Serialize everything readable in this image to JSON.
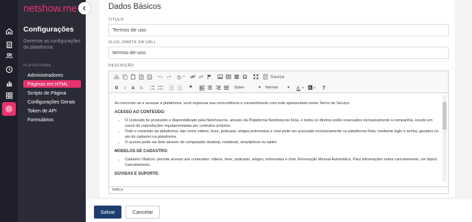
{
  "brand": {
    "logo_text": "netshow.me",
    "logo_color": "#e8336f"
  },
  "iconbar": [
    "home-icon",
    "document-icon",
    "users-icon",
    "clock-icon",
    "chart-icon",
    "apps-icon",
    "gear-icon"
  ],
  "sidebar": {
    "title": "Configurações",
    "subtitle": "Gerencie as configurações da plataforma",
    "section_label": "PLATAFORMA",
    "items": [
      {
        "label": "Administradores",
        "active": false
      },
      {
        "label": "Páginas em HTML",
        "active": true
      },
      {
        "label": "Scripts de Página",
        "active": false
      },
      {
        "label": "Configurações Gerais",
        "active": false
      },
      {
        "label": "Token de API",
        "active": false
      },
      {
        "label": "Formulários",
        "active": false
      }
    ]
  },
  "main": {
    "page_title": "Dados Básicos",
    "fields": {
      "title_label": "TÍTULO",
      "title_value": "Termos de uso",
      "slug_label": "SLUG (PARTE DA URL)",
      "slug_value": "termos-de-uso",
      "desc_label": "DESCRIÇÃO"
    },
    "editor": {
      "toolbar": {
        "source_label": "Source",
        "styles_label": "Styles",
        "format_label": "Normal"
      },
      "content": {
        "intro": "Ao inscrever-se e acessar a plataforma, você expressa sua concordância e consentimento com tudo apresentado neste Termo de Serviço.",
        "heading1": "ACESSO AO CONTEÚDO:",
        "list1": [
          "O conteúdo foi produzido e disponibilizado pela Netshow.me, através da Plataforma Netshow.me Flow, e todos os direitos estão reservados exclusivamente à companhia, exceto em casos de coproduções regulamentadas por contratos próprios.",
          "Todo o conteúdo da plataforma, tais como vídeos, lives, podcasts, artigos,entrevistas e chat pode ser acessado exclusivamente na plataforma Flow, mediante login e senha, gerados no ato do cadastro na plataforma.",
          "O acesso pode ser feito através de computador desktop, notebook, smartphone ou tablet."
        ],
        "heading2": "MODELOS DE CADASTRO:",
        "list2": [
          "Cadastro Vitalício: permite acesso aos conteúdos: vídeos, lives, podcasts, artigos, entrevistas e chat. Renovação Mensal Automática. Para informações sobre cancelamento, ver tópico Cancelamento."
        ],
        "heading3": "DÚVIDAS E SUPORTE:"
      },
      "statusbar": "body  p"
    }
  },
  "footer": {
    "save_label": "Salvar",
    "cancel_label": "Cancelar"
  }
}
